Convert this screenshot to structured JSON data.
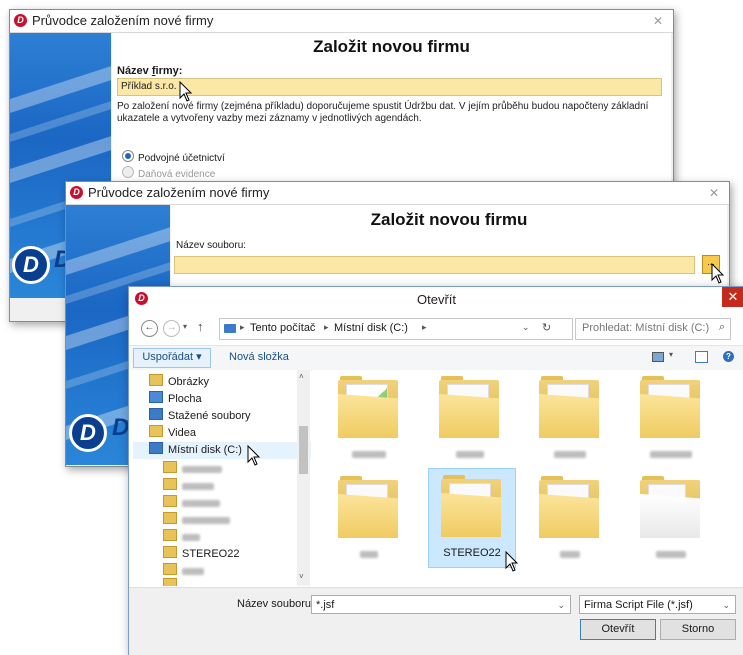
{
  "wizard1": {
    "title": "Průvodce založením nové firmy",
    "heading": "Založit novou firmu",
    "name_label_prefix": "Název ",
    "name_label_underlined": "f",
    "name_label_suffix": "irmy:",
    "name_value": "Příklad s.r.o.",
    "info_text": "Po založení nové firmy (zejména příkladu) doporučujeme spustit Údržbu dat. V jejím průběhu budou napočteny základní ukazatele a vytvořeny vazby mezi záznamy v jednotlivých agendách.",
    "radio_options": [
      {
        "label": "Podvojné účetnictví",
        "selected": true,
        "enabled": true
      },
      {
        "label": "Daňová evidence",
        "selected": false,
        "enabled": false
      }
    ]
  },
  "wizard2": {
    "title": "Průvodce založením nové firmy",
    "heading": "Založit novou firmu",
    "file_label": "Název souboru:",
    "browse_label": "..."
  },
  "dialog": {
    "title": "Otevřít",
    "close_label": "✕",
    "breadcrumb": [
      "Tento počítač",
      "Místní disk (C:)"
    ],
    "search_placeholder": "Prohledat: Místní disk (C:)",
    "organize_label": "Uspořádat ▾",
    "new_folder_label": "Nová složka",
    "tree_items": [
      {
        "label": "Obrázky",
        "blurred": false
      },
      {
        "label": "Plocha",
        "blurred": false
      },
      {
        "label": "Stažené soubory",
        "blurred": false
      },
      {
        "label": "Videa",
        "blurred": false
      },
      {
        "label": "Místní disk (C:)",
        "blurred": false,
        "selected": true
      },
      {
        "label": "",
        "blurred": true
      },
      {
        "label": "",
        "blurred": true
      },
      {
        "label": "",
        "blurred": true
      },
      {
        "label": "",
        "blurred": true
      },
      {
        "label": "",
        "blurred": true
      },
      {
        "label": "STEREO22",
        "blurred": false
      },
      {
        "label": "",
        "blurred": true
      },
      {
        "label": "",
        "blurred": true
      }
    ],
    "folders": [
      {
        "label": "",
        "blurred": true
      },
      {
        "label": "",
        "blurred": true
      },
      {
        "label": "",
        "blurred": true
      },
      {
        "label": "",
        "blurred": true
      },
      {
        "label": "",
        "blurred": true
      },
      {
        "label": "STEREO22",
        "blurred": false,
        "selected": true
      },
      {
        "label": "",
        "blurred": true
      },
      {
        "label": "",
        "blurred": true
      }
    ],
    "filename_label": "Název souboru:",
    "filename_value": "*.jsf",
    "filetype_value": "Firma Script File (*.jsf)",
    "open_button": "Otevřít",
    "cancel_button": "Storno"
  },
  "colors": {
    "accent_red": "#c8102e",
    "field_yellow": "#fbe8a6",
    "selection_blue": "#cce8ff",
    "stripe_blue": "#1b67c4"
  },
  "icons": [
    "app-logo-icon",
    "back-arrow-icon",
    "forward-arrow-icon",
    "up-arrow-icon",
    "refresh-icon",
    "search-icon",
    "view-icon",
    "help-icon",
    "folder-icon",
    "drive-icon"
  ]
}
